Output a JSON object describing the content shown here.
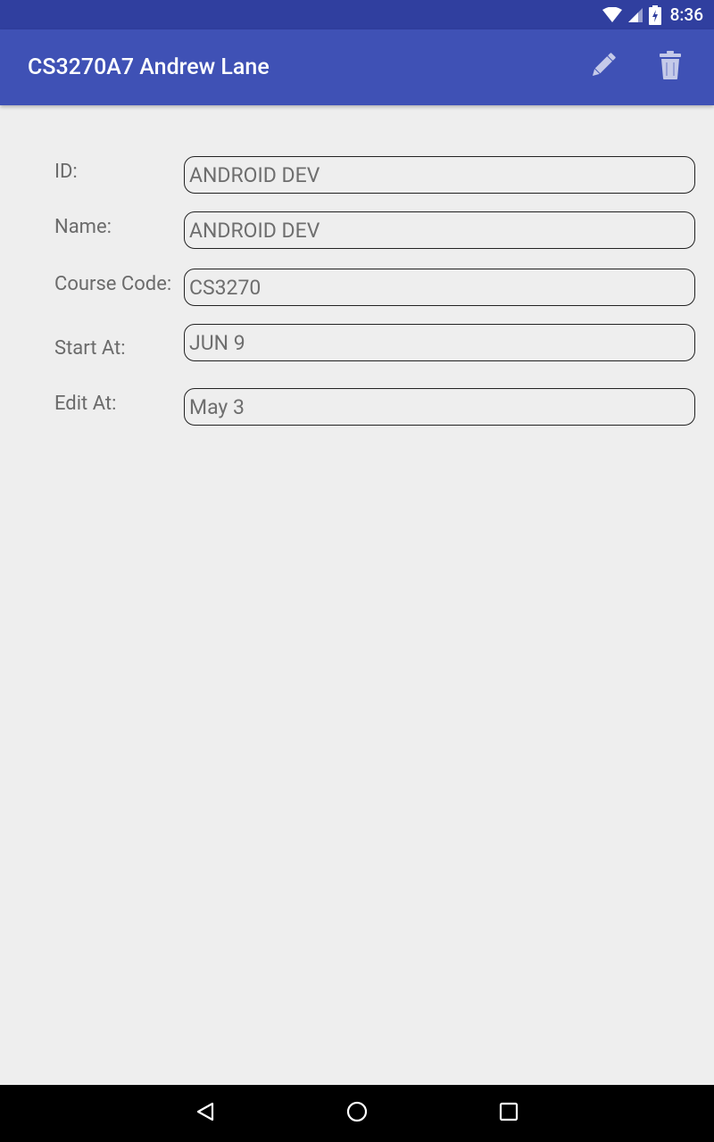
{
  "status_bar": {
    "time": "8:36",
    "icons": [
      "wifi-icon",
      "cellular-signal-icon",
      "battery-charging-icon"
    ]
  },
  "app_bar": {
    "title": "CS3270A7 Andrew Lane",
    "actions": [
      {
        "name": "edit",
        "icon": "pencil-icon"
      },
      {
        "name": "delete",
        "icon": "trash-icon"
      }
    ],
    "colors": {
      "app_bar": "#3f51b5",
      "status_bar": "#303f9f"
    }
  },
  "form": {
    "id": {
      "label": "ID:",
      "value": "ANDROID DEV"
    },
    "name": {
      "label": "Name:",
      "value": "ANDROID DEV"
    },
    "course_code": {
      "label": "Course Code:",
      "value": "CS3270"
    },
    "start_at": {
      "label": "Start At:",
      "value": "JUN 9"
    },
    "edit_at": {
      "label": "Edit At:",
      "value": "May 3"
    }
  },
  "nav_bar": {
    "buttons": [
      "back-icon",
      "home-icon",
      "recents-icon"
    ]
  }
}
